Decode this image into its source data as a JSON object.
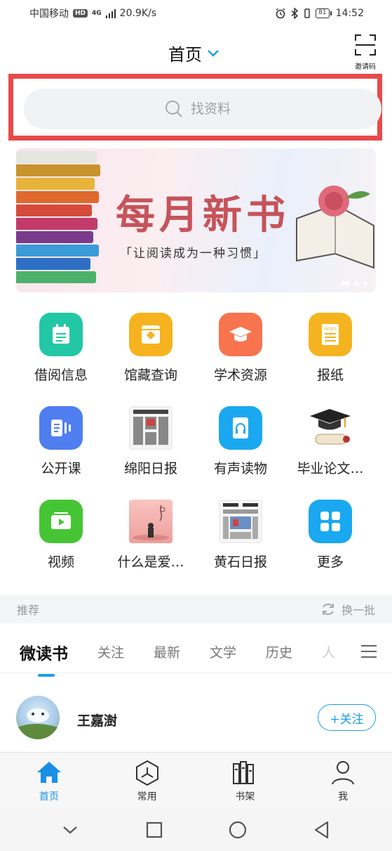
{
  "status_bar": {
    "carrier": "中国移动",
    "hd": "HD",
    "network": "4G",
    "speed": "20.9K/s",
    "battery": "81",
    "time": "14:52"
  },
  "header": {
    "title": "首页",
    "qr_label": "邀请码"
  },
  "search": {
    "placeholder": "找资料"
  },
  "banner": {
    "title": "每月新书",
    "subtitle": "「让阅读成为一种习惯」"
  },
  "grid": {
    "items": [
      {
        "label": "借阅信息",
        "icon": "borrow-info-icon",
        "color": "#22c7a5"
      },
      {
        "label": "馆藏查询",
        "icon": "collection-search-icon",
        "color": "#f6b31f"
      },
      {
        "label": "学术资源",
        "icon": "academic-cap-icon",
        "color": "#f7744e"
      },
      {
        "label": "报纸",
        "icon": "newspaper-icon",
        "color": "#f5b41f"
      },
      {
        "label": "公开课",
        "icon": "open-course-icon",
        "color": "#4f7ef0"
      },
      {
        "label": "绵阳日报",
        "icon": "mianyang-daily-thumbnail",
        "color": "#dddddd"
      },
      {
        "label": "有声读物",
        "icon": "audiobook-icon",
        "color": "#1aa8f0"
      },
      {
        "label": "毕业论文…",
        "icon": "graduation-thesis-thumbnail",
        "color": "#ffffff"
      },
      {
        "label": "视频",
        "icon": "video-icon",
        "color": "#46c534"
      },
      {
        "label": "什么是爱…",
        "icon": "love-thumbnail",
        "color": "#f3b4b0"
      },
      {
        "label": "黄石日报",
        "icon": "huangshi-daily-thumbnail",
        "color": "#dddddd"
      },
      {
        "label": "更多",
        "icon": "more-grid-icon",
        "color": "#1aa8f0"
      }
    ]
  },
  "recommend": {
    "label": "推荐",
    "refresh_label": "换一批"
  },
  "tabs": [
    {
      "label": "微读书"
    },
    {
      "label": "关注"
    },
    {
      "label": "最新"
    },
    {
      "label": "文学"
    },
    {
      "label": "历史"
    },
    {
      "label": "人"
    }
  ],
  "feed": {
    "name": "王嘉澍",
    "follow_label": "+关注"
  },
  "bottom_nav": [
    {
      "label": "首页"
    },
    {
      "label": "常用"
    },
    {
      "label": "书架"
    },
    {
      "label": "我"
    }
  ],
  "colors": {
    "accent": "#1a9fe6",
    "highlight_border": "#e84a4a",
    "banner_title": "#c6535a"
  }
}
